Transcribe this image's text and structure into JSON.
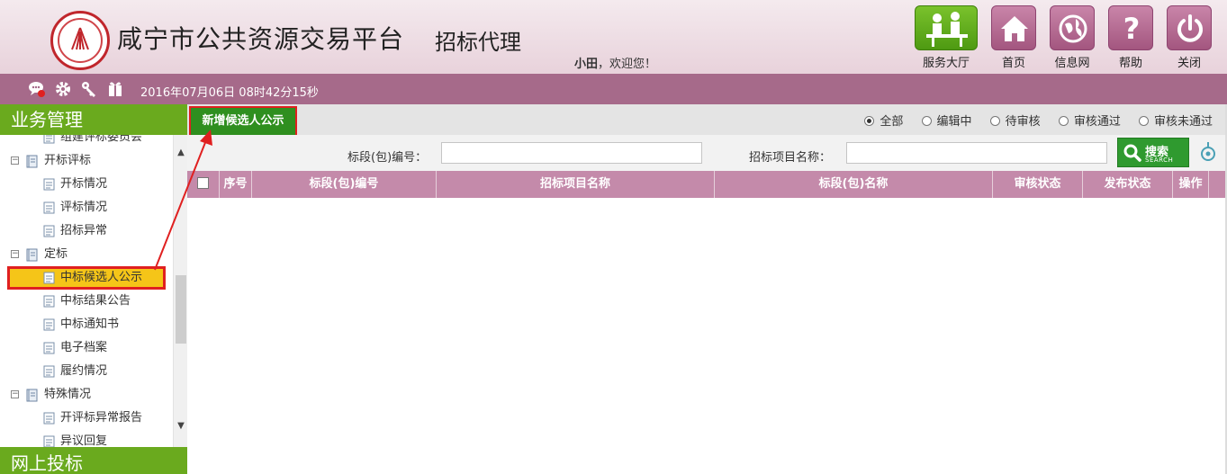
{
  "header": {
    "site_title": "咸宁市公共资源交易平台",
    "module_title": "招标代理",
    "user_name": "小田",
    "welcome_suffix": "，欢迎您！",
    "buttons": [
      {
        "label": "服务大厅",
        "icon": "service-hall-icon"
      },
      {
        "label": "首页",
        "icon": "home-icon"
      },
      {
        "label": "信息网",
        "icon": "globe-icon"
      },
      {
        "label": "帮助",
        "icon": "help-icon"
      },
      {
        "label": "关闭",
        "icon": "power-icon"
      }
    ]
  },
  "topbar": {
    "icons": [
      "message-icon",
      "gear-icon",
      "key-icon",
      "gift-icon"
    ],
    "datetime": "2016年07月06日 08时42分15秒"
  },
  "sidebar": {
    "section_title": "业务管理",
    "footer_title": "网上投标",
    "tree": [
      {
        "label": "组建评标委员会",
        "level": 2
      },
      {
        "label": "开标评标",
        "level": 1
      },
      {
        "label": "开标情况",
        "level": 2
      },
      {
        "label": "评标情况",
        "level": 2
      },
      {
        "label": "招标异常",
        "level": 2
      },
      {
        "label": "定标",
        "level": 1
      },
      {
        "label": "中标候选人公示",
        "level": 2,
        "active": true
      },
      {
        "label": "中标结果公告",
        "level": 2
      },
      {
        "label": "中标通知书",
        "level": 2
      },
      {
        "label": "电子档案",
        "level": 2
      },
      {
        "label": "履约情况",
        "level": 2
      },
      {
        "label": "特殊情况",
        "level": 1
      },
      {
        "label": "开评标异常报告",
        "level": 2
      },
      {
        "label": "异议回复",
        "level": 2
      }
    ]
  },
  "toolbar": {
    "add_label": "新增候选人公示",
    "filters": [
      {
        "label": "全部",
        "checked": true
      },
      {
        "label": "编辑中",
        "checked": false
      },
      {
        "label": "待审核",
        "checked": false
      },
      {
        "label": "审核通过",
        "checked": false
      },
      {
        "label": "审核未通过",
        "checked": false
      }
    ]
  },
  "search": {
    "section_no_label": "标段(包)编号：",
    "section_no_value": "",
    "project_name_label": "招标项目名称：",
    "project_name_value": "",
    "button_label": "搜索",
    "button_sub": "SEARCH"
  },
  "table": {
    "columns": [
      "序号",
      "标段(包)编号",
      "招标项目名称",
      "标段(包)名称",
      "审核状态",
      "发布状态",
      "操作"
    ],
    "rows": []
  },
  "colors": {
    "header_pink": "#e8d2db",
    "topbar_purple": "#a66a8a",
    "accent_green": "#6aaa1e",
    "table_head": "#c48aaa",
    "highlight_red": "#e02020"
  }
}
